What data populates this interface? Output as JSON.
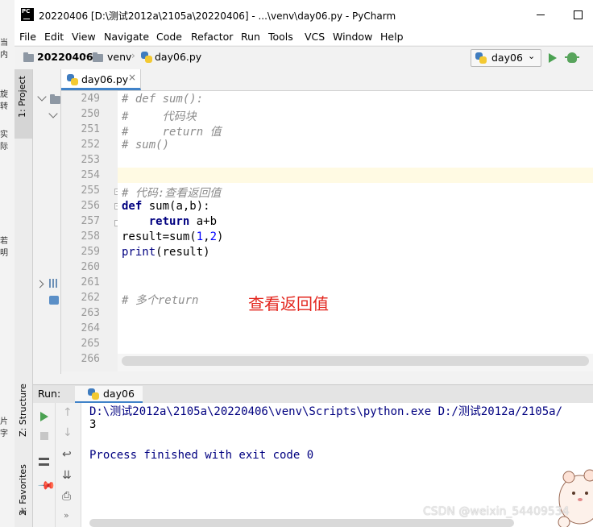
{
  "background_window": {
    "fragments": [
      "当内",
      "旋转",
      "实际",
      "若明",
      "片字"
    ]
  },
  "titlebar": {
    "logo_text": "PC",
    "title": "20220406 [D:\\测试2012a\\2105a\\20220406] - ...\\venv\\day06.py - PyCharm"
  },
  "menu": [
    "File",
    "Edit",
    "View",
    "Navigate",
    "Code",
    "Refactor",
    "Run",
    "Tools",
    "VCS",
    "Window",
    "Help"
  ],
  "navbar": {
    "breadcrumb": [
      "20220406",
      "venv",
      "day06.py"
    ],
    "run_config": "day06"
  },
  "left_stripe": {
    "project_tab": "1: Project",
    "structure_tab": "Z: Structure",
    "favorites_tab": "2: Favorites"
  },
  "editor": {
    "tab_label": "day06.py",
    "line_numbers": [
      "249",
      "250",
      "251",
      "252",
      "253",
      "254",
      "255",
      "256",
      "257",
      "258",
      "259",
      "260",
      "261",
      "262",
      "263",
      "264",
      "265",
      "266"
    ],
    "code_lines": {
      "l249": "# def sum():",
      "l250": "#     代码块",
      "l251": "#     return 值",
      "l252": "# sum()",
      "l255": "# 代码:查看返回值",
      "l256_kw": "def",
      "l256_rest": " sum(a,b):",
      "l257_indent": "    ",
      "l257_kw": "return",
      "l257_rest": " a+b",
      "l258_pre": "result=sum(",
      "l258_n1": "1",
      "l258_sep": ",",
      "l258_n2": "2",
      "l258_post": ")",
      "l259_bi": "print",
      "l259_rest": "(result)",
      "l262": "# 多个return"
    },
    "annotation": "查看返回值"
  },
  "run_panel": {
    "label": "Run:",
    "tab": "day06",
    "output": [
      "D:\\测试2012a\\2105a\\20220406\\venv\\Scripts\\python.exe D:/测试2012a/2105a/",
      "3",
      "",
      "Process finished with exit code 0"
    ]
  },
  "watermark": "CSDN @weixin_54409534",
  "colors": {
    "keyword": "#000080",
    "comment": "#8c8c8c",
    "number": "#0000ff",
    "annotation": "#e3261e",
    "caret_line": "#fffae3",
    "accent": "#4083c9"
  }
}
